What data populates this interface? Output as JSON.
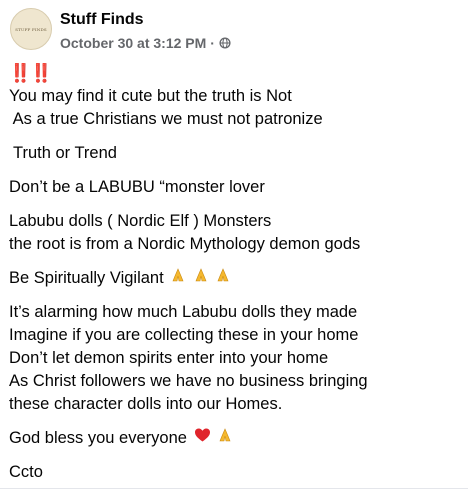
{
  "post": {
    "author": "Stuff Finds",
    "avatar_text": "STUFF FINDS",
    "timestamp": "October 30 at 3:12 PM",
    "separator": "·",
    "privacy_icon": "globe-icon",
    "alert": "‼️‼️",
    "lines": [
      "You may find it cute but the truth is Not",
      " As a true Christians we must not patronize",
      "Truth or Trend",
      "Don’t be a LABUBU “monster lover",
      "Labubu dolls ( Nordic Elf ) Monsters",
      "the root is from a Nordic Mythology demon gods",
      "Be Spiritually Vigilant",
      "It’s alarming how much Labubu dolls they made",
      "Imagine if you are collecting these in your home",
      "Don’t let demon spirits enter into your home",
      "As Christ followers we have no business bringing",
      "these character dolls into our Homes.",
      "God bless you everyone",
      "Ccto"
    ],
    "emoji_icons": {
      "vigilant": [
        "praying-hands-icon",
        "praying-hands-icon",
        "praying-hands-icon"
      ],
      "bless": [
        "red-heart-icon",
        "praying-hands-icon"
      ]
    },
    "colors": {
      "text": "#050505",
      "meta": "#65676b",
      "alert_red": "#e0242b",
      "heart_red": "#e0242b",
      "hands_gold": "#f5b82e"
    }
  }
}
